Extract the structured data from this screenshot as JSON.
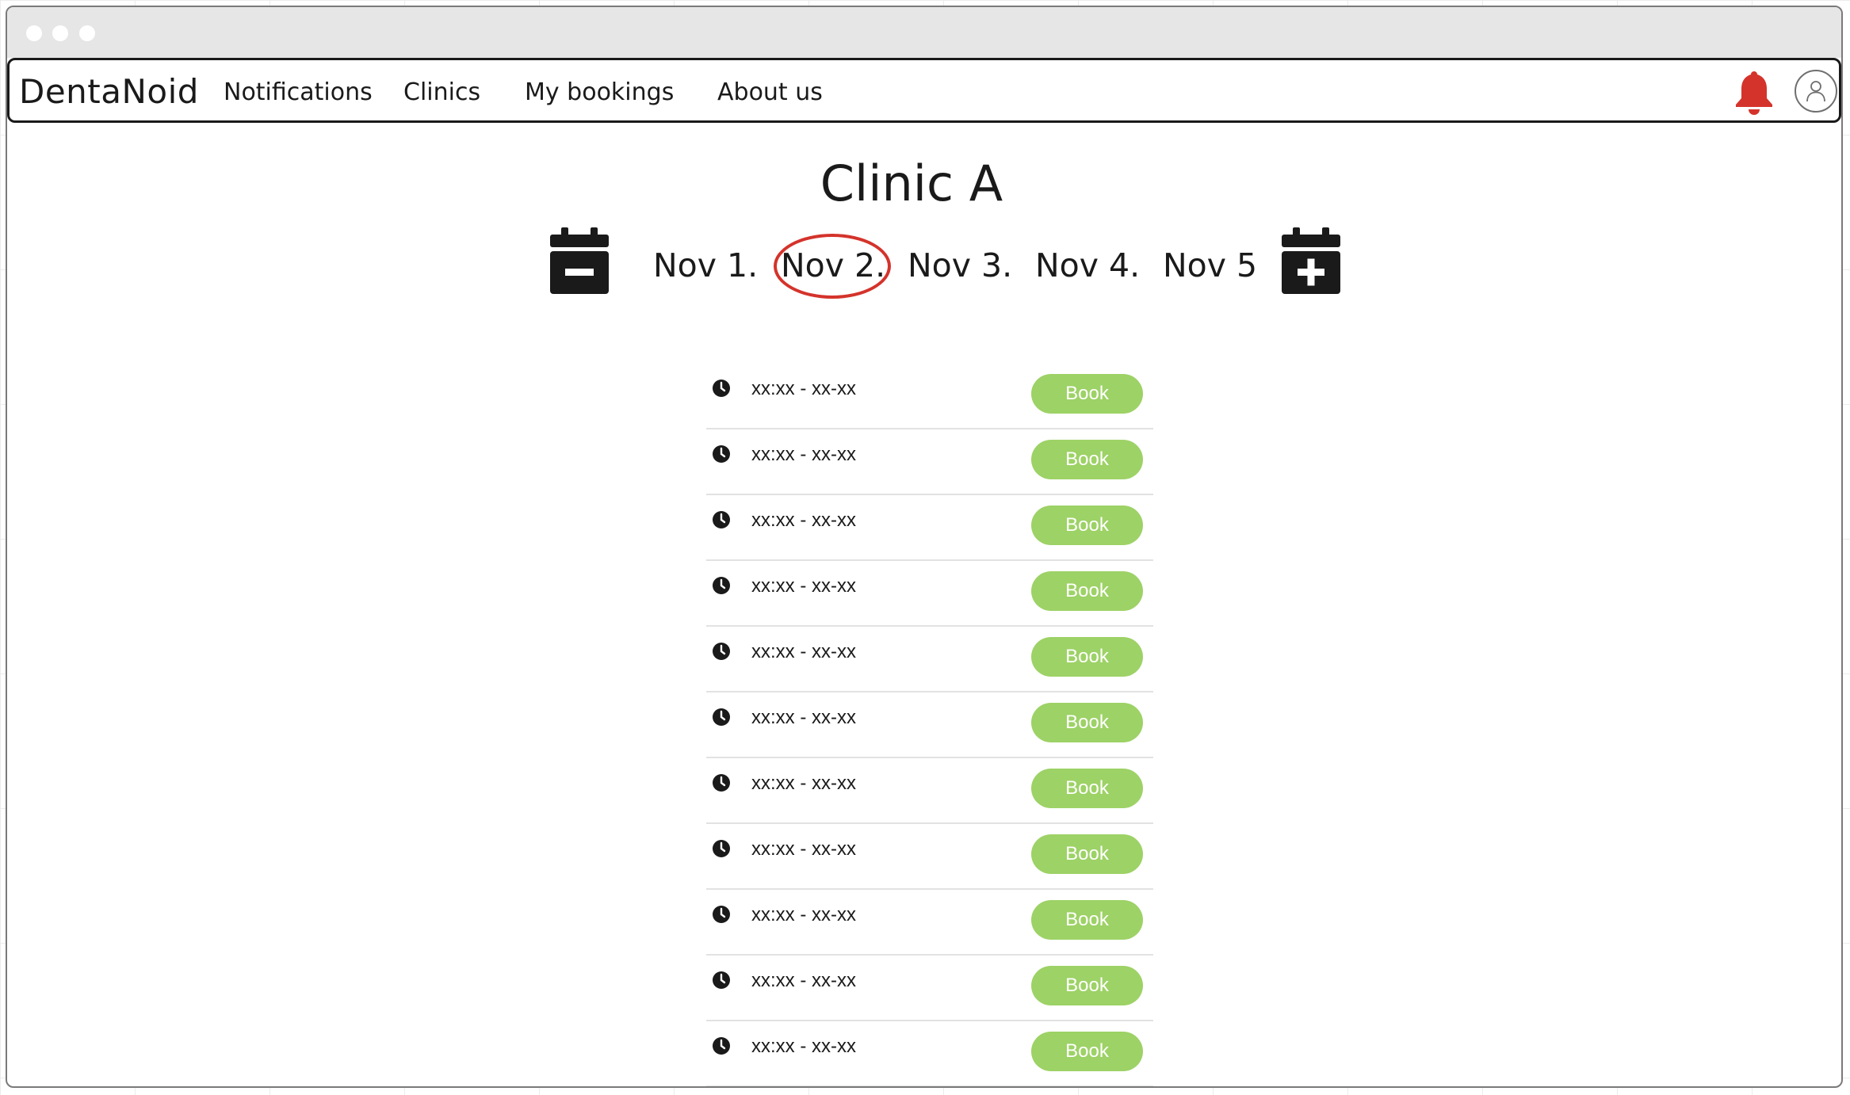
{
  "navbar": {
    "brand": "DentaNoid",
    "links": [
      "Notifications",
      "Clinics",
      "My bookings",
      "About us"
    ],
    "bell_icon": "bell-icon",
    "profile_icon": "user-icon",
    "bell_color": "#d4332b"
  },
  "page": {
    "title": "Clinic A",
    "prev_icon": "calendar-minus-icon",
    "next_icon": "calendar-plus-icon",
    "days": [
      "Nov 1.",
      "Nov 2.",
      "Nov 3.",
      "Nov 4.",
      "Nov 5"
    ],
    "selected_day": "Nov 2."
  },
  "slots": {
    "clock_icon": "clock-icon",
    "items": [
      {
        "time": "xx:xx - xx-xx",
        "button": "Book"
      },
      {
        "time": "xx:xx - xx-xx",
        "button": "Book"
      },
      {
        "time": "xx:xx - xx-xx",
        "button": "Book"
      },
      {
        "time": "xx:xx - xx-xx",
        "button": "Book"
      },
      {
        "time": "xx:xx - xx-xx",
        "button": "Book"
      },
      {
        "time": "xx:xx - xx-xx",
        "button": "Book"
      },
      {
        "time": "xx:xx - xx-xx",
        "button": "Book"
      },
      {
        "time": "xx:xx - xx-xx",
        "button": "Book"
      },
      {
        "time": "xx:xx - xx-xx",
        "button": "Book"
      },
      {
        "time": "xx:xx - xx-xx",
        "button": "Book"
      },
      {
        "time": "xx:xx - xx-xx",
        "button": "Book"
      }
    ],
    "button_color": "#9dd266"
  }
}
